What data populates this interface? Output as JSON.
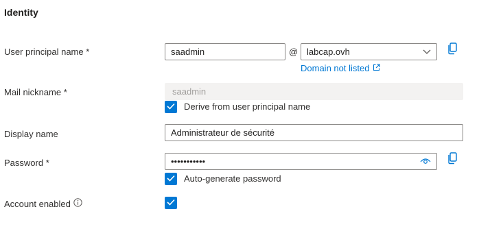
{
  "section": {
    "title": "Identity"
  },
  "upn": {
    "label": "User principal name *",
    "value": "saadmin",
    "at": "@",
    "domain": "labcap.ovh",
    "domain_link": "Domain not listed"
  },
  "mail": {
    "label": "Mail nickname *",
    "value": "saadmin",
    "derive_label": "Derive from user principal name"
  },
  "display": {
    "label": "Display name",
    "value": "Administrateur de sécurité"
  },
  "password": {
    "label": "Password *",
    "value": "•••••••••••",
    "autogen_label": "Auto-generate password"
  },
  "account": {
    "label": "Account enabled"
  },
  "colors": {
    "accent": "#0078d4",
    "border": "#8a8886",
    "disabled_bg": "#f3f2f1"
  }
}
